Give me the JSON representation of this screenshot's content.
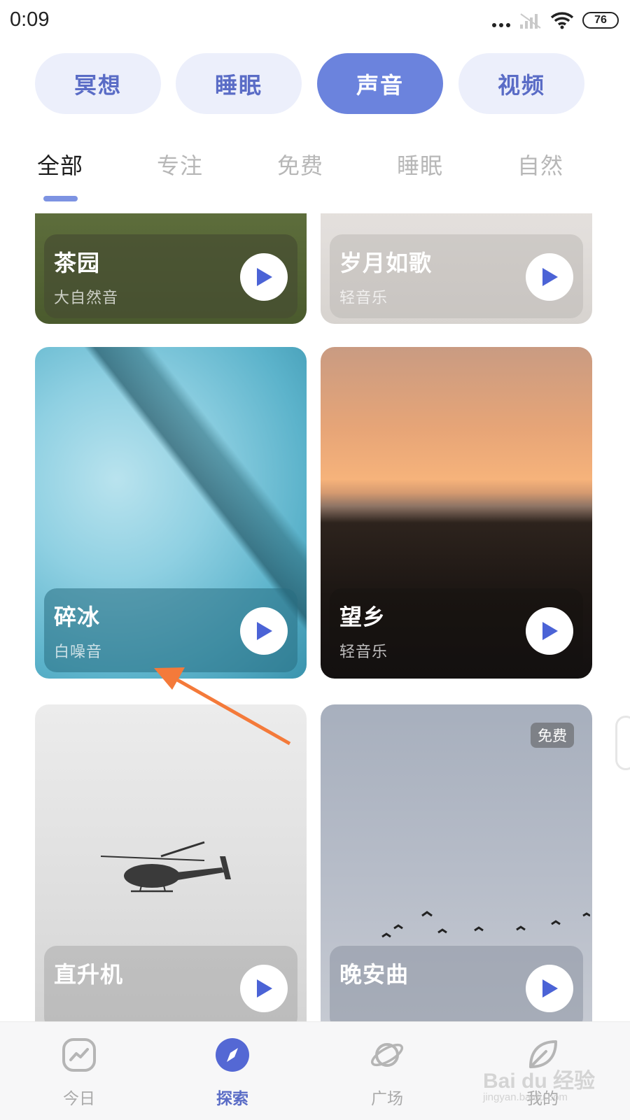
{
  "status_bar": {
    "time": "0:09",
    "battery": "76"
  },
  "categories": [
    {
      "label": "冥想",
      "active": false
    },
    {
      "label": "睡眠",
      "active": false
    },
    {
      "label": "声音",
      "active": true
    },
    {
      "label": "视频",
      "active": false
    }
  ],
  "subtabs": [
    {
      "label": "全部",
      "active": true
    },
    {
      "label": "专注",
      "active": false
    },
    {
      "label": "免费",
      "active": false
    },
    {
      "label": "睡眠",
      "active": false
    },
    {
      "label": "自然",
      "active": false
    }
  ],
  "cards": [
    {
      "title": "茶园",
      "subtitle": "大自然音",
      "badge": ""
    },
    {
      "title": "岁月如歌",
      "subtitle": "轻音乐",
      "badge": ""
    },
    {
      "title": "碎冰",
      "subtitle": "白噪音",
      "badge": ""
    },
    {
      "title": "望乡",
      "subtitle": "轻音乐",
      "badge": ""
    },
    {
      "title": "直升机",
      "subtitle": "",
      "badge": ""
    },
    {
      "title": "晚安曲",
      "subtitle": "",
      "badge": "免费"
    }
  ],
  "bottom_nav": [
    {
      "label": "今日",
      "icon": "trend-icon",
      "active": false
    },
    {
      "label": "探索",
      "icon": "compass-icon",
      "active": true
    },
    {
      "label": "广场",
      "icon": "planet-icon",
      "active": false
    },
    {
      "label": "我的",
      "icon": "leaf-icon",
      "active": false
    }
  ],
  "watermark": {
    "text": "Bai du 经验",
    "sub": "jingyan.baidu.com"
  },
  "colors": {
    "accent": "#6b83dd",
    "pill_bg": "#eceffb",
    "pill_text": "#5a6cc6",
    "arrow": "#f47a3a",
    "play_icon": "#4b63d6"
  }
}
